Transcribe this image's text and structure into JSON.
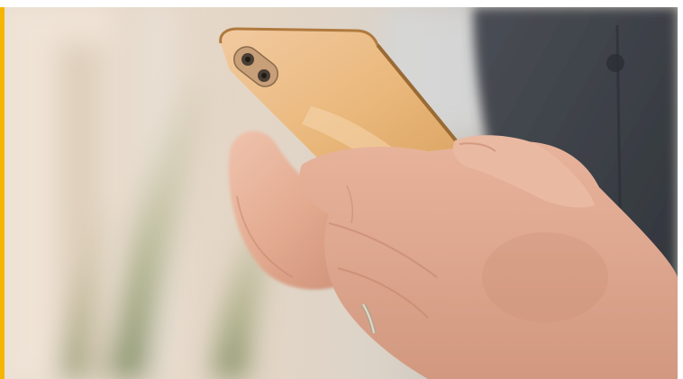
{
  "image": {
    "alt": "",
    "accent_color": "#F6B500"
  },
  "colors": {
    "background_left": "#e9ddd0",
    "shirt": "#3a3e45",
    "phone_gold": "#e7b776",
    "skin": "#e4b096"
  }
}
